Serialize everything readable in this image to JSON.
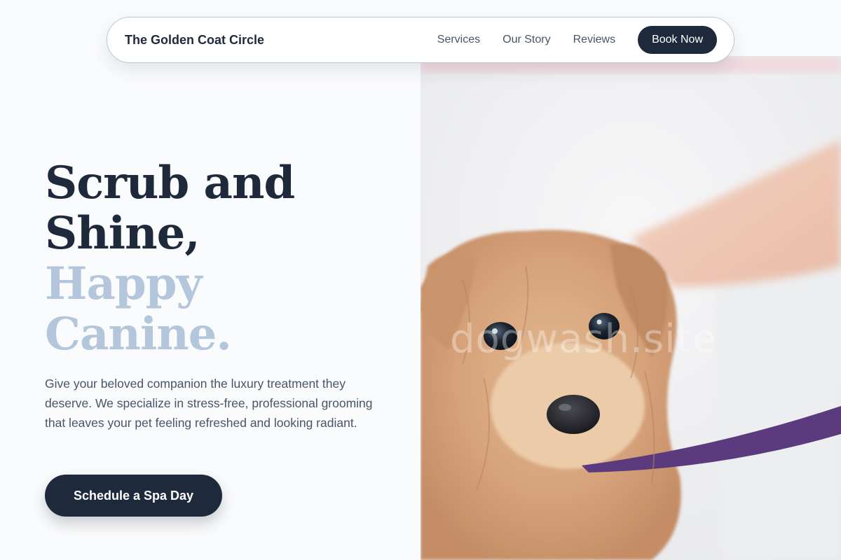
{
  "nav": {
    "brand": "The Golden Coat Circle",
    "links": [
      "Services",
      "Our Story",
      "Reviews"
    ],
    "cta_label": "Book Now"
  },
  "hero": {
    "title_line1": "Scrub and",
    "title_line2": "Shine,",
    "title_line3": "Happy",
    "title_line4": "Canine.",
    "description": "Give your beloved companion the luxury treatment they deserve. We specialize in stress-free, professional grooming that leaves your pet feeling refreshed and looking radiant.",
    "cta_label": "Schedule a Spa Day",
    "watermark": "dogwash.site"
  },
  "colors": {
    "primary": "#1e293b",
    "accent_light": "#b4c6dc",
    "body_text": "#475569",
    "background": "#fafbfc"
  }
}
